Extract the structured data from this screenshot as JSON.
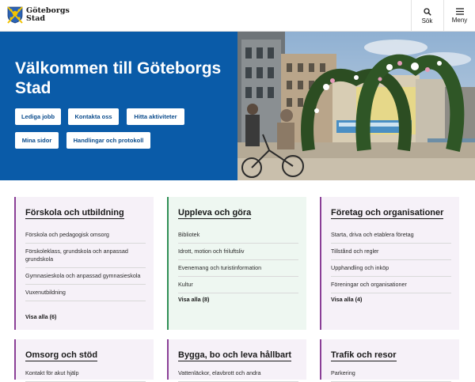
{
  "header": {
    "logo_line1": "Göteborgs",
    "logo_line2": "Stad",
    "search_label": "Sök",
    "menu_label": "Meny"
  },
  "hero": {
    "title": "Välkommen till Göteborgs Stad",
    "buttons": [
      "Lediga jobb",
      "Kontakta oss",
      "Hitta aktiviteter",
      "Mina sidor",
      "Handlingar och protokoll"
    ]
  },
  "cards": [
    {
      "title": "Förskola och utbildning",
      "items": [
        "Förskola och pedagogisk omsorg",
        "Förskoleklass, grundskola och anpassad grundskola",
        "Gymnasieskola och anpassad gymnasieskola",
        "Vuxenutbildning"
      ],
      "link": "Visa alla (6)"
    },
    {
      "title": "Uppleva och göra",
      "items": [
        "Bibliotek",
        "Idrott, motion och friluftsliv",
        "Evenemang och turistinformation",
        "Kultur"
      ],
      "link": "Visa alla (8)"
    },
    {
      "title": "Företag och organisationer",
      "items": [
        "Starta, driva och etablera företag",
        "Tillstånd och regler",
        "Upphandling och inköp",
        "Föreningar och organisationer"
      ],
      "link": "Visa alla (4)"
    },
    {
      "title": "Omsorg och stöd",
      "items": [
        "Kontakt för akut hjälp"
      ]
    },
    {
      "title": "Bygga, bo och leva hållbart",
      "items": [
        "Vattenläckor, elavbrott och andra"
      ]
    },
    {
      "title": "Trafik och resor",
      "items": [
        "Parkering"
      ]
    }
  ],
  "colors": {
    "hero_blue": "#0a5ba8",
    "purple_accent": "#8a3f97",
    "green_accent": "#2f8f55"
  }
}
